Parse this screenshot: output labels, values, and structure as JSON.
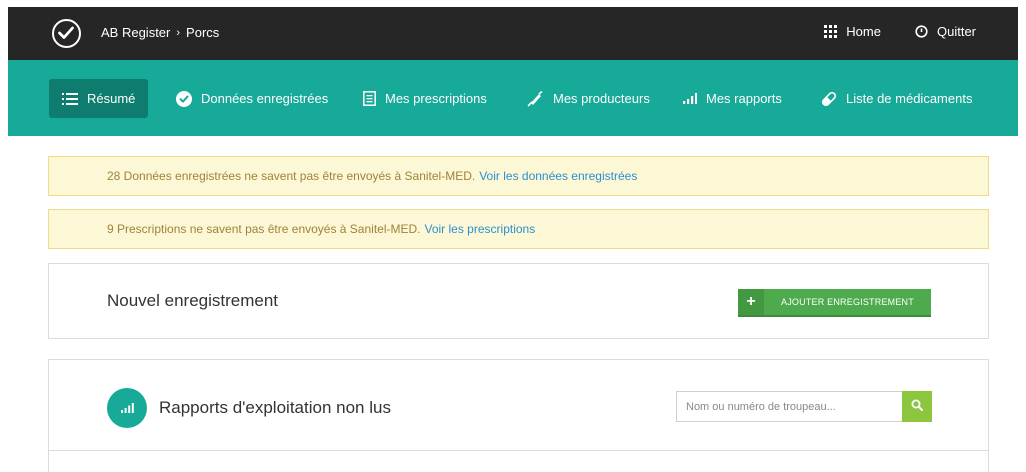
{
  "topbar": {
    "app": "AB Register",
    "separator": "›",
    "section": "Porcs",
    "home": "Home",
    "quit": "Quitter"
  },
  "nav": {
    "items": [
      {
        "label": "Résumé",
        "icon": "list-icon",
        "active": true
      },
      {
        "label": "Données enregistrées",
        "icon": "check-circle-icon",
        "active": false
      },
      {
        "label": "Mes prescriptions",
        "icon": "document-icon",
        "active": false
      },
      {
        "label": "Mes producteurs",
        "icon": "syringe-icon",
        "active": false
      },
      {
        "label": "Mes rapports",
        "icon": "bar-chart-icon",
        "active": false
      },
      {
        "label": "Liste de médicaments",
        "icon": "pill-icon",
        "active": false
      }
    ]
  },
  "alerts": [
    {
      "text": "28 Données enregistrées ne savent pas être envoyés à Sanitel-MED.",
      "link": "Voir les données enregistrées"
    },
    {
      "text": "9 Prescriptions ne savent pas être envoyés à Sanitel-MED.",
      "link": "Voir les prescriptions"
    }
  ],
  "new_record": {
    "title": "Nouvel enregistrement",
    "button": "AJOUTER ENREGISTREMENT"
  },
  "reports": {
    "title": "Rapports d'exploitation non lus",
    "search_placeholder": "Nom ou numéro de troupeau..."
  },
  "colors": {
    "teal": "#17aa98",
    "teal_dark": "#0e7c6f",
    "green": "#4dab4d",
    "lime": "#8cc63f",
    "alert_bg": "#fcf8d6",
    "link": "#2b8fcf"
  }
}
